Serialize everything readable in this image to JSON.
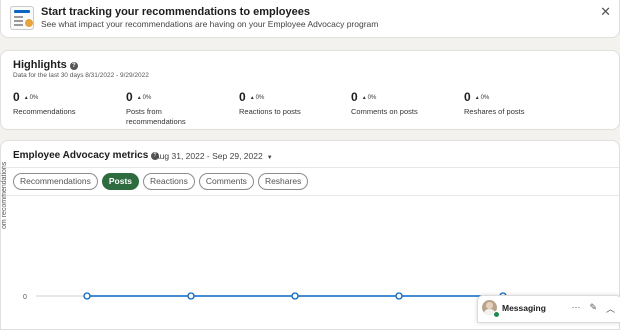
{
  "banner": {
    "title": "Start tracking your recommendations to employees",
    "subtitle": "See what impact your recommendations are having on your Employee Advocacy program",
    "close_icon": "close-icon"
  },
  "highlights": {
    "title": "Highlights",
    "period": "Data for the last 30 days 8/31/2022 - 9/29/2022",
    "stats": [
      {
        "value": "0",
        "delta": "0%",
        "label": "Recommendations"
      },
      {
        "value": "0",
        "delta": "0%",
        "label": "Posts from recommendations"
      },
      {
        "value": "0",
        "delta": "0%",
        "label": "Reactions to posts"
      },
      {
        "value": "0",
        "delta": "0%",
        "label": "Comments on posts"
      },
      {
        "value": "0",
        "delta": "0%",
        "label": "Reshares of posts"
      }
    ]
  },
  "metrics": {
    "title": "Employee Advocacy metrics",
    "date_range": "Aug 31, 2022 - Sep 29, 2022",
    "tabs": [
      "Recommendations",
      "Posts",
      "Reactions",
      "Comments",
      "Reshares"
    ],
    "active_tab": "Posts",
    "y_label": "om recommendations",
    "y_tick": "0"
  },
  "chart_data": {
    "type": "line",
    "series": [
      {
        "values": [
          0,
          0,
          0,
          0,
          0
        ]
      }
    ],
    "ylim": [
      0,
      0
    ],
    "line_color": "#0a66c2"
  },
  "messaging": {
    "label": "Messaging",
    "icons": [
      "more-icon",
      "compose-icon",
      "chevron-up-icon"
    ]
  },
  "colors": {
    "accent_green": "#2e6b3f",
    "line_blue": "#0a66c2"
  }
}
